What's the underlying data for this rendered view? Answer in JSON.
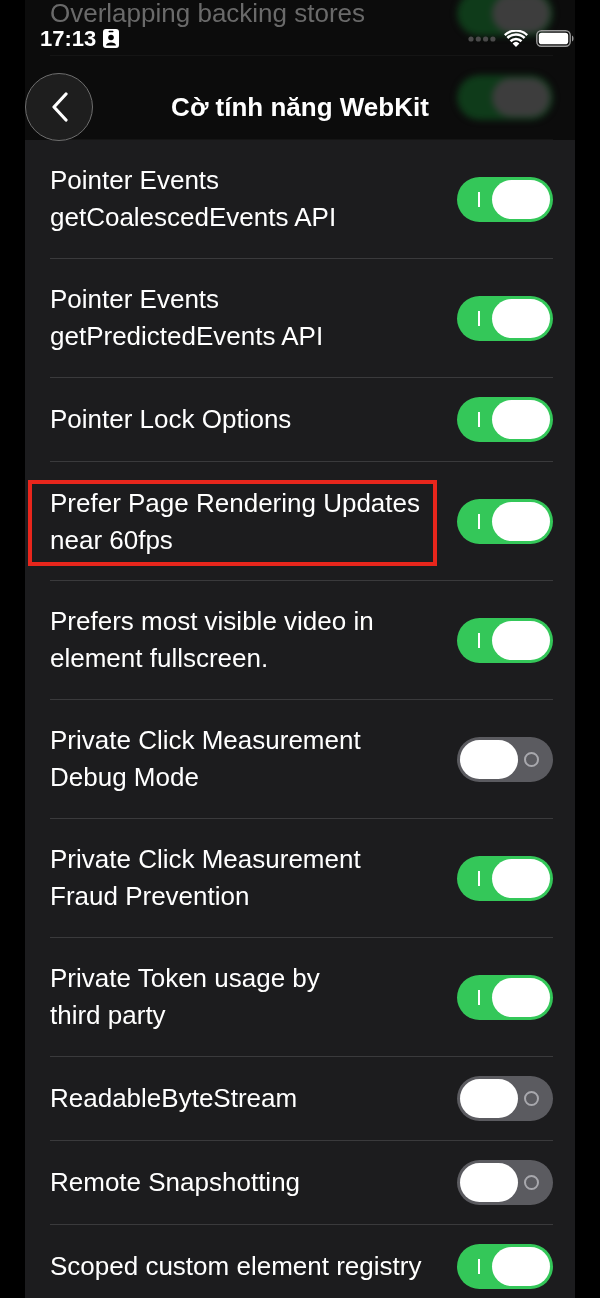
{
  "status_bar": {
    "time": "17:13"
  },
  "navigation": {
    "title": "Cờ tính năng WebKit"
  },
  "scrolled_under": [
    {
      "label": "Overlapping backing stores",
      "on": true
    },
    {
      "on": true
    }
  ],
  "rows": [
    {
      "lines": [
        "Pointer Events",
        "getCoalescedEvents API"
      ],
      "on": true,
      "highlighted": false
    },
    {
      "lines": [
        "Pointer Events",
        "getPredictedEvents API"
      ],
      "on": true,
      "highlighted": false
    },
    {
      "lines": [
        "Pointer Lock Options"
      ],
      "on": true,
      "highlighted": false
    },
    {
      "lines": [
        "Prefer Page Rendering Updates",
        "near 60fps"
      ],
      "on": true,
      "highlighted": true
    },
    {
      "lines": [
        "Prefers most visible video in",
        "element fullscreen."
      ],
      "on": true,
      "highlighted": false
    },
    {
      "lines": [
        "Private Click Measurement",
        "Debug Mode"
      ],
      "on": false,
      "highlighted": false
    },
    {
      "lines": [
        "Private Click Measurement",
        "Fraud Prevention"
      ],
      "on": true,
      "highlighted": false
    },
    {
      "lines": [
        "Private Token usage by",
        "third party"
      ],
      "on": true,
      "highlighted": false
    },
    {
      "lines": [
        "ReadableByteStream"
      ],
      "on": false,
      "highlighted": false
    },
    {
      "lines": [
        "Remote Snapshotting"
      ],
      "on": false,
      "highlighted": false
    },
    {
      "lines": [
        "Scoped custom element registry"
      ],
      "on": true,
      "highlighted": false
    }
  ]
}
